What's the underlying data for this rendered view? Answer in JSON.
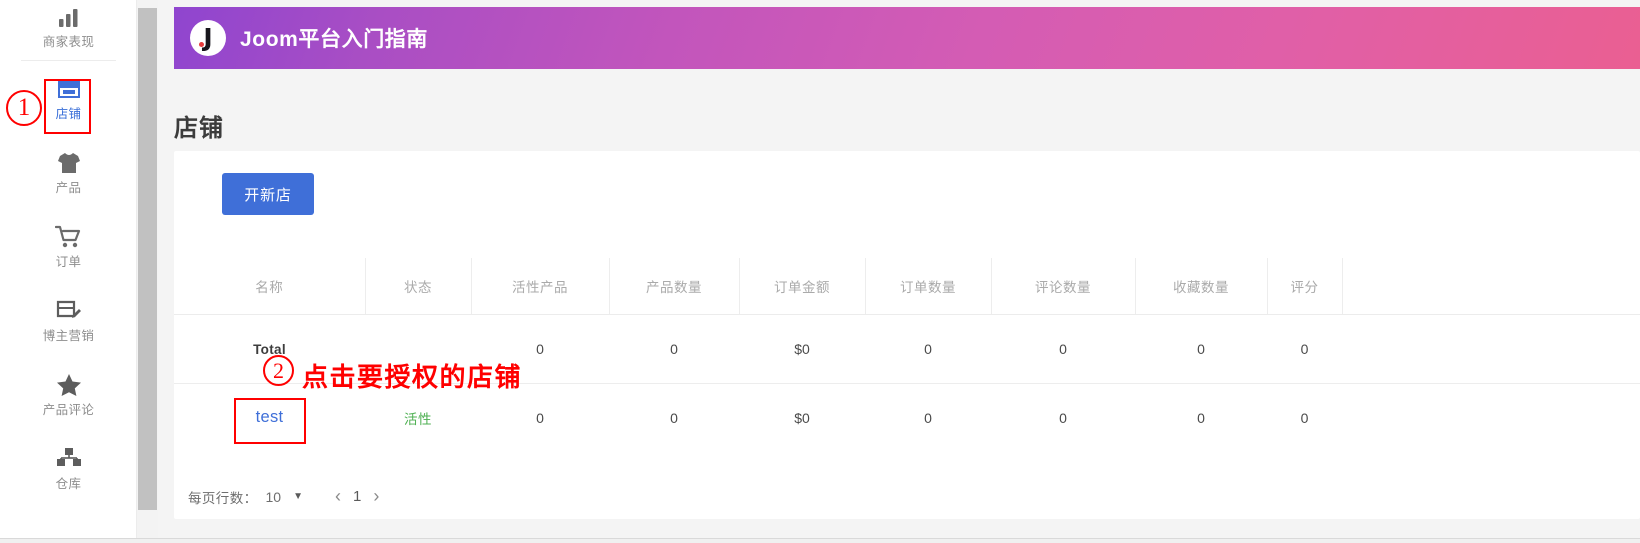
{
  "sidebar": {
    "items": [
      {
        "label": "商家表现",
        "icon": "bar-chart-icon",
        "active": false
      },
      {
        "label": "店铺",
        "icon": "storefront-icon",
        "active": true
      },
      {
        "label": "产品",
        "icon": "tshirt-icon",
        "active": false
      },
      {
        "label": "订单",
        "icon": "shopping-cart-icon",
        "active": false
      },
      {
        "label": "博主营销",
        "icon": "document-pencil-icon",
        "active": false
      },
      {
        "label": "产品评论",
        "icon": "star-icon",
        "active": false
      },
      {
        "label": "仓库",
        "icon": "warehouse-boxes-icon",
        "active": false
      }
    ]
  },
  "banner": {
    "title": "Joom平台入门指南",
    "logo_letter": "J",
    "gradient_from": "#8f45cf",
    "gradient_to": "#ea5f92"
  },
  "page": {
    "title": "店铺"
  },
  "toolbar": {
    "new_store_label": "开新店",
    "new_store_color": "#3f6fd8"
  },
  "table": {
    "headers": [
      "名称",
      "状态",
      "活性产品",
      "产品数量",
      "订单金额",
      "订单数量",
      "评论数量",
      "收藏数量",
      "评分"
    ],
    "rows": [
      {
        "type": "total",
        "name": "Total",
        "status": "",
        "active_products": "0",
        "product_count": "0",
        "order_amount": "$0",
        "order_count": "0",
        "review_count": "0",
        "favorite_count": "0",
        "rating": "0"
      },
      {
        "type": "store",
        "name": "test",
        "status": "活性",
        "active_products": "0",
        "product_count": "0",
        "order_amount": "$0",
        "order_count": "0",
        "review_count": "0",
        "favorite_count": "0",
        "rating": "0"
      }
    ],
    "link_color": "#3f6fd8",
    "status_color": "#4caf50"
  },
  "pagination": {
    "rows_per_page_label": "每页行数：",
    "rows_per_page_value": "10",
    "caret": "▼",
    "prev": "‹",
    "page": "1",
    "next": "›"
  },
  "annotations": {
    "marker_1": "①",
    "marker_1_number": "1",
    "marker_2_number": "2",
    "marker_2_text": "点击要授权的店铺",
    "color": "#ff0000"
  }
}
